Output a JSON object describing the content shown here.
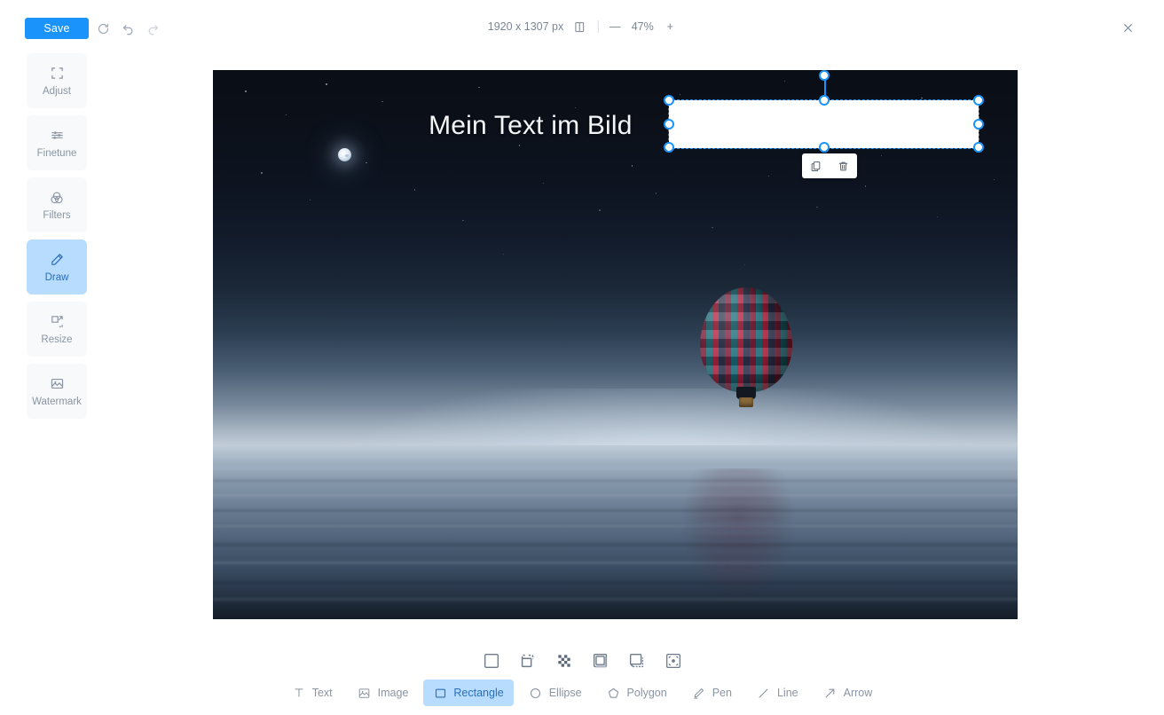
{
  "topbar": {
    "save_label": "Save",
    "history": [
      {
        "name": "reset-icon",
        "title": "Reset"
      },
      {
        "name": "undo-icon",
        "title": "Undo"
      },
      {
        "name": "redo-icon",
        "title": "Redo"
      }
    ],
    "dimensions": "1920 x 1307 px",
    "compare_icon": "split-view-icon",
    "zoom_out_label": "—",
    "zoom_value": "47%",
    "zoom_in_label": "+",
    "close_icon": "close-icon"
  },
  "sidebar": {
    "items": [
      {
        "label": "Adjust",
        "icon": "crop-icon",
        "active": false
      },
      {
        "label": "Finetune",
        "icon": "sliders-icon",
        "active": false
      },
      {
        "label": "Filters",
        "icon": "filters-icon",
        "active": false
      },
      {
        "label": "Draw",
        "icon": "pencil-icon",
        "active": true
      },
      {
        "label": "Resize",
        "icon": "resize-icon",
        "active": false
      },
      {
        "label": "Watermark",
        "icon": "watermark-icon",
        "active": false
      }
    ]
  },
  "canvas": {
    "text_layer": "Mein Text im Bild",
    "selected_shape": "rectangle",
    "context_menu": [
      {
        "name": "duplicate-icon",
        "label": "Duplicate"
      },
      {
        "name": "delete-icon",
        "label": "Delete"
      }
    ]
  },
  "style_row": {
    "options": [
      {
        "name": "fill-solid-icon",
        "active": false
      },
      {
        "name": "fill-dashed-icon",
        "active": false
      },
      {
        "name": "fill-transparent-icon",
        "active": false
      },
      {
        "name": "shadow-icon",
        "active": false
      },
      {
        "name": "layers-icon",
        "active": false
      },
      {
        "name": "corner-radius-icon",
        "active": false
      }
    ]
  },
  "tools": {
    "items": [
      {
        "label": "Text",
        "icon": "text-icon",
        "active": false
      },
      {
        "label": "Image",
        "icon": "image-icon",
        "active": false
      },
      {
        "label": "Rectangle",
        "icon": "rectangle-icon",
        "active": true
      },
      {
        "label": "Ellipse",
        "icon": "ellipse-icon",
        "active": false
      },
      {
        "label": "Polygon",
        "icon": "polygon-icon",
        "active": false
      },
      {
        "label": "Pen",
        "icon": "pen-icon",
        "active": false
      },
      {
        "label": "Line",
        "icon": "line-icon",
        "active": false
      },
      {
        "label": "Arrow",
        "icon": "arrow-icon",
        "active": false
      }
    ]
  },
  "colors": {
    "accent": "#1a94fb",
    "accent_soft": "#b8dcfe",
    "accent_text": "#2a6fb8",
    "muted_text": "#8a94a2",
    "panel_bg": "#f7f9fb"
  }
}
